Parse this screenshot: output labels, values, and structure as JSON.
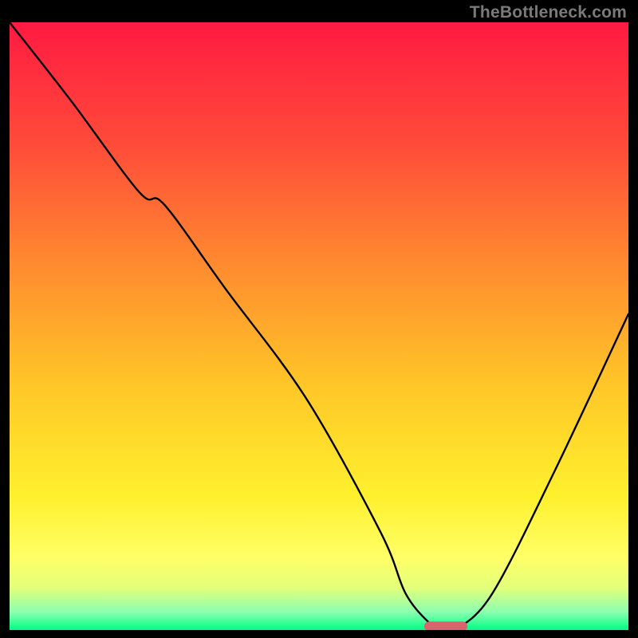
{
  "watermark": "TheBottleneck.com",
  "chart_data": {
    "type": "line",
    "title": "",
    "xlabel": "",
    "ylabel": "",
    "xlim": [
      0,
      100
    ],
    "ylim": [
      0,
      100
    ],
    "grid": false,
    "legend": false,
    "background_gradient": {
      "stops": [
        {
          "offset": 0.0,
          "color": "#ff1a42"
        },
        {
          "offset": 0.2,
          "color": "#ff4b3a"
        },
        {
          "offset": 0.4,
          "color": "#ff8b2f"
        },
        {
          "offset": 0.6,
          "color": "#ffc728"
        },
        {
          "offset": 0.78,
          "color": "#fff02e"
        },
        {
          "offset": 0.88,
          "color": "#ffff66"
        },
        {
          "offset": 0.93,
          "color": "#e4ff7a"
        },
        {
          "offset": 0.97,
          "color": "#8cffb0"
        },
        {
          "offset": 1.0,
          "color": "#00ff88"
        }
      ]
    },
    "series": [
      {
        "name": "bottleneck-curve",
        "x": [
          0,
          10,
          21,
          25,
          35,
          48,
          60,
          64,
          68,
          70,
          72,
          78,
          88,
          100
        ],
        "y": [
          100,
          87,
          72,
          70,
          56,
          38,
          16,
          6,
          1,
          0,
          0,
          6,
          26,
          52
        ]
      }
    ],
    "marker": {
      "name": "optimal-range-marker",
      "x_start": 67,
      "x_end": 74,
      "y": 0.6,
      "color": "#d9646e"
    }
  }
}
